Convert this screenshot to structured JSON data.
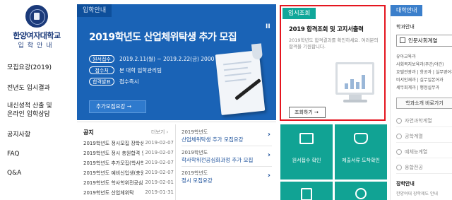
{
  "sidebar": {
    "school_name": "한양여자대학교",
    "school_sub": "입학안내",
    "items": [
      {
        "label": "모집요강(2019)"
      },
      {
        "label": "전년도 입시결과"
      },
      {
        "label": "내신성적 산출 및"
      },
      {
        "label": "온라인 입학상담"
      },
      {
        "label": "공지사항"
      },
      {
        "label": "FAQ"
      },
      {
        "label": "Q&A"
      }
    ]
  },
  "admission": {
    "tab": "입학안내",
    "title": "2019학년도 산업체위탁생 추가 모집",
    "rows": [
      {
        "pill": "원서접수",
        "text": "2019.2.11(월) ~ 2019.2.22(금) 2000"
      },
      {
        "pill": "접수처",
        "text": "본 대학 입학관리팀"
      },
      {
        "pill": "합격발표",
        "text": "접수즉시"
      }
    ],
    "button": "추가모집요강 →",
    "pause": "II"
  },
  "notice": {
    "title": "공지",
    "more": "더보기 ›",
    "items": [
      {
        "title": "2019학년도 정시모집 장학생 자",
        "date": "2019-02-07"
      },
      {
        "title": "2019학년도 정시 충원합격 안",
        "date": "2019-02-07"
      },
      {
        "title": "2019학년도 추가모집(학사학",
        "date": "2019-02-07"
      },
      {
        "title": "2019학년도 예비신입생(충원",
        "date": "2019-02-07"
      },
      {
        "title": "2019학년도 학사학위전공심",
        "date": "2019-02-01"
      },
      {
        "title": "2019학년도 산업체위탁",
        "date": "2019-01-31"
      }
    ]
  },
  "links": [
    {
      "year": "2019학년도",
      "title": "산업체위탁생 추가 모집요강"
    },
    {
      "year": "2019학년도",
      "title": "학사학위전공심화과정 추가 모집"
    },
    {
      "year": "2019학년도",
      "title": "정시 모집요강"
    }
  ],
  "result": {
    "tab": "입시조회",
    "title": "2019 합격조회 및 고지서출력",
    "desc": "2019학년도 합격결과를 확인하세요. 여러분의 합격을 기원합니다.",
    "button": "조회하기 →"
  },
  "tiles": [
    {
      "label": "원서접수 확인"
    },
    {
      "label": "제출서류 도착확인"
    }
  ],
  "college": {
    "tab": "대학안내",
    "sub": "학과안내",
    "select": "인문사회계열",
    "list": [
      "유아교육과",
      "사회복지보육과(주간/야간)",
      "호텔관광과 | 항공과 | 실무영어과",
      "비서인재과 | 실무일본어과",
      "세무회계과 | 행정실무과"
    ],
    "button": "학과소개 바로가기",
    "options": [
      "자연과학계열",
      "공학계열",
      "예체능계열",
      "융합전공"
    ],
    "scholar_title": "장학안내",
    "scholar_desc": "한양여대 장학제도 안내"
  },
  "colors": {
    "blue": "#1a63b6",
    "teal": "#11a394",
    "red": "#e4151f",
    "navy": "#1b3a7a"
  }
}
